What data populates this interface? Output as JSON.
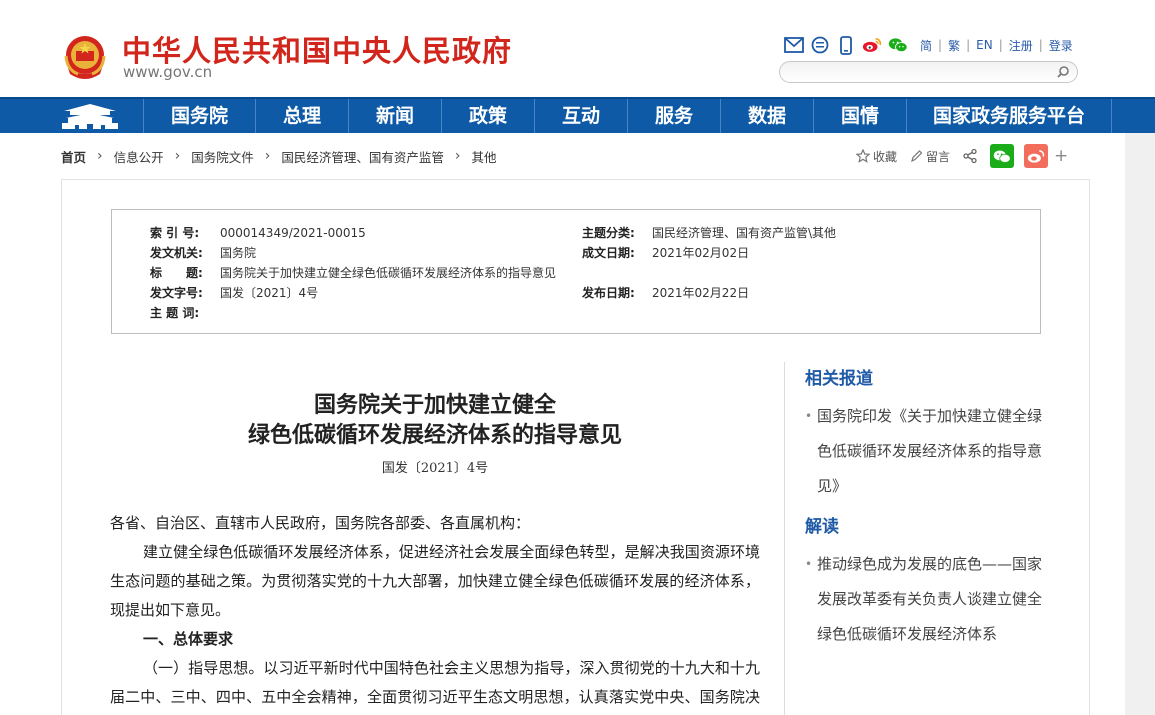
{
  "header": {
    "site_title": "中华人民共和国中央人民政府",
    "site_url": "www.gov.cn",
    "icons": [
      "mail-icon",
      "chat-icon",
      "mobile-icon",
      "weibo-icon",
      "wechat-icon"
    ],
    "lang": [
      "简",
      "繁",
      "EN",
      "注册",
      "登录"
    ],
    "search_placeholder": ""
  },
  "nav": {
    "items": [
      "国务院",
      "总理",
      "新闻",
      "政策",
      "互动",
      "服务",
      "数据",
      "国情",
      "国家政务服务平台"
    ]
  },
  "breadcrumb": [
    "首页",
    "信息公开",
    "国务院文件",
    "国民经济管理、国有资产监管",
    "其他"
  ],
  "tools": {
    "favorite": "收藏",
    "comment": "留言",
    "plus": "+"
  },
  "meta": {
    "index_label": "索 引 号:",
    "index_value": "000014349/2021-00015",
    "topic_label": "主题分类:",
    "topic_value": "国民经济管理、国有资产监管\\其他",
    "issuer_label": "发文机关:",
    "issuer_value": "国务院",
    "created_label": "成文日期:",
    "created_value": "2021年02月02日",
    "title_label": "标　　题:",
    "title_value": "国务院关于加快建立健全绿色低碳循环发展经济体系的指导意见",
    "docno_label": "发文字号:",
    "docno_value": "国发〔2021〕4号",
    "published_label": "发布日期:",
    "published_value": "2021年02月22日",
    "keywords_label": "主 题 词:",
    "keywords_value": ""
  },
  "document": {
    "title_line1": "国务院关于加快建立健全",
    "title_line2": "绿色低碳循环发展经济体系的指导意见",
    "doc_number": "国发〔2021〕4号",
    "address": "各省、自治区、直辖市人民政府，国务院各部委、各直属机构：",
    "intro": "建立健全绿色低碳循环发展经济体系，促进经济社会发展全面绿色转型，是解决我国资源环境生态问题的基础之策。为贯彻落实党的十九大部署，加快建立健全绿色低碳循环发展的经济体系，现提出如下意见。",
    "section1": "一、总体要求",
    "item1_label": "（一）指导思想。",
    "item1_text": "以习近平新时代中国特色社会主义思想为指导，深入贯彻党的十九大和十九届二中、三中、四中、五中全会精神，全面贯彻习近平生态文明思想，认真落实党中央、国务院决策部署，坚定不移贯彻新发展理念，全方位全过程推行绿色规划、绿色设计"
  },
  "aside": {
    "related_title": "相关报道",
    "related_items": [
      "国务院印发《关于加快建立健全绿色低碳循环发展经济体系的指导意见》"
    ],
    "interp_title": "解读",
    "interp_items": [
      "推动绿色成为发展的底色——国家发展改革委有关负责人谈建立健全绿色低碳循环发展经济体系"
    ]
  },
  "colors": {
    "brand_red": "#d2261d",
    "nav_blue": "#0e5aa7",
    "link_blue": "#1f5aa6",
    "wechat_green": "#1aad19",
    "weibo_orange": "#f26d5b"
  }
}
